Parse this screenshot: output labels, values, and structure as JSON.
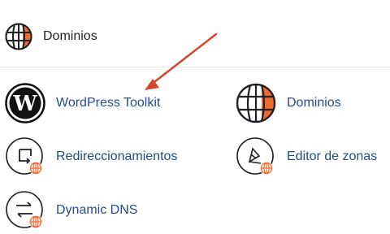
{
  "section": {
    "title": "Dominios",
    "icon": "globe-icon"
  },
  "tools": [
    {
      "label": "WordPress Toolkit",
      "icon": "wordpress-icon"
    },
    {
      "label": "Dominios",
      "icon": "globe-icon"
    },
    {
      "label": "Redireccionamientos",
      "icon": "redirect-icon"
    },
    {
      "label": "Editor de zonas",
      "icon": "zone-editor-icon"
    },
    {
      "label": "Dynamic DNS",
      "icon": "dynamic-dns-icon"
    }
  ],
  "colors": {
    "accent": "#ec6b2d",
    "link": "#234c8e",
    "annotation_arrow": "#d4452b"
  }
}
